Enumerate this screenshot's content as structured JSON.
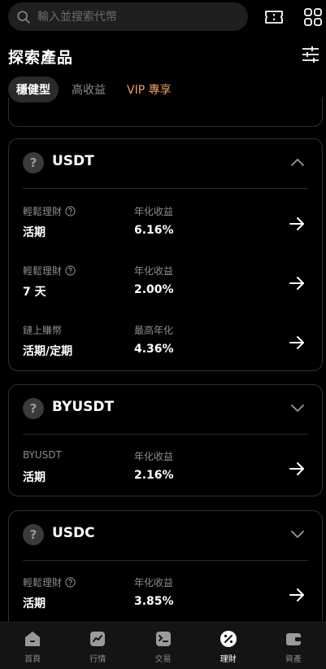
{
  "search": {
    "placeholder": "輸入並搜索代幣"
  },
  "header": {
    "title": "探索產品"
  },
  "tabs": [
    {
      "label": "穩健型",
      "active": true
    },
    {
      "label": "高收益",
      "active": false
    },
    {
      "label": "VIP 專享",
      "active": false,
      "accent": "#e9a15a"
    }
  ],
  "cards": [
    {
      "coin": "USDT",
      "expanded": true,
      "rows": [
        {
          "type_label": "輕鬆理財",
          "term": "活期",
          "rate_label": "年化收益",
          "rate": "6.16%"
        },
        {
          "type_label": "輕鬆理財",
          "term": "7 天",
          "rate_label": "年化收益",
          "rate": "2.00%"
        },
        {
          "type_label": "鏈上賺幣",
          "term": "活期/定期",
          "rate_label": "最高年化",
          "rate": "4.36%"
        }
      ]
    },
    {
      "coin": "BYUSDT",
      "expanded": false,
      "rows": [
        {
          "type_label": "BYUSDT",
          "term": "活期",
          "rate_label": "年化收益",
          "rate": "2.16%"
        }
      ]
    },
    {
      "coin": "USDC",
      "expanded": false,
      "rows": [
        {
          "type_label": "輕鬆理財",
          "term": "活期",
          "rate_label": "年化收益",
          "rate": "3.85%"
        }
      ]
    }
  ],
  "coin_icon_glyph": "?",
  "bottom_nav": [
    {
      "label": "首頁",
      "icon": "home-icon",
      "active": false
    },
    {
      "label": "行情",
      "icon": "chart-icon",
      "active": false
    },
    {
      "label": "交易",
      "icon": "trade-icon",
      "active": false
    },
    {
      "label": "理財",
      "icon": "percent-icon",
      "active": true
    },
    {
      "label": "資產",
      "icon": "wallet-icon",
      "active": false
    }
  ]
}
